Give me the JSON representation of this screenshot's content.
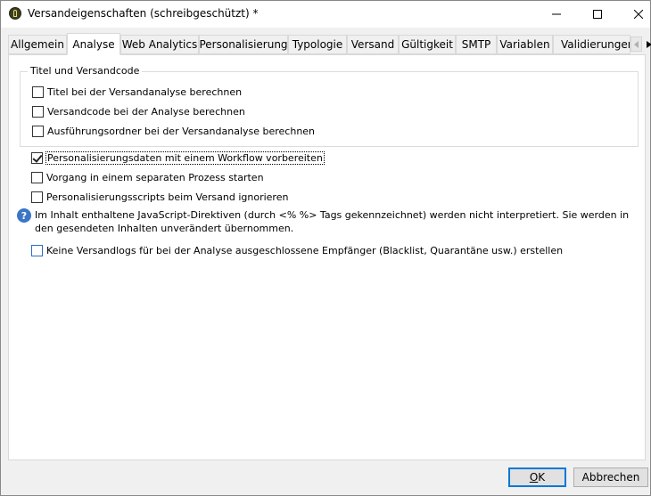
{
  "window": {
    "title": "Versandeigenschaften (schreibgeschützt) *"
  },
  "tabs": [
    {
      "label": "Allgemein",
      "active": false
    },
    {
      "label": "Analyse",
      "active": true
    },
    {
      "label": "Web Analytics",
      "active": false
    },
    {
      "label": "Personalisierung",
      "active": false
    },
    {
      "label": "Typologie",
      "active": false
    },
    {
      "label": "Versand",
      "active": false
    },
    {
      "label": "Gültigkeit",
      "active": false
    },
    {
      "label": "SMTP",
      "active": false
    },
    {
      "label": "Variablen",
      "active": false
    },
    {
      "label": "Validierungen",
      "active": false
    }
  ],
  "group": {
    "legend": "Titel und Versandcode",
    "options": [
      {
        "label": "Titel bei der Versandanalyse berechnen",
        "checked": false
      },
      {
        "label": "Versandcode bei der Analyse berechnen",
        "checked": false
      },
      {
        "label": "Ausführungsordner bei der Versandanalyse berechnen",
        "checked": false
      }
    ]
  },
  "options": [
    {
      "label": "Personalisierungsdaten mit einem Workflow vorbereiten",
      "checked": true
    },
    {
      "label": "Vorgang in einem separaten Prozess starten",
      "checked": false
    },
    {
      "label": "Personalisierungsscripts beim Versand ignorieren",
      "checked": false
    }
  ],
  "info": {
    "icon": "question-icon",
    "text": "Im Inhalt enthaltene JavaScript-Direktiven (durch <% %> Tags gekennzeichnet) werden nicht interpretiert. Sie werden in den gesendeten Inhalten unverändert übernommen."
  },
  "blacklist_option": {
    "label": "Keine Versandlogs für bei der Analyse ausgeschlossene Empfänger (Blacklist, Quarantäne usw.) erstellen",
    "checked": false
  },
  "buttons": {
    "ok": "OK",
    "cancel": "Abbrechen"
  },
  "colors": {
    "accent": "#0078d7",
    "info_icon": "#3b76c6"
  }
}
